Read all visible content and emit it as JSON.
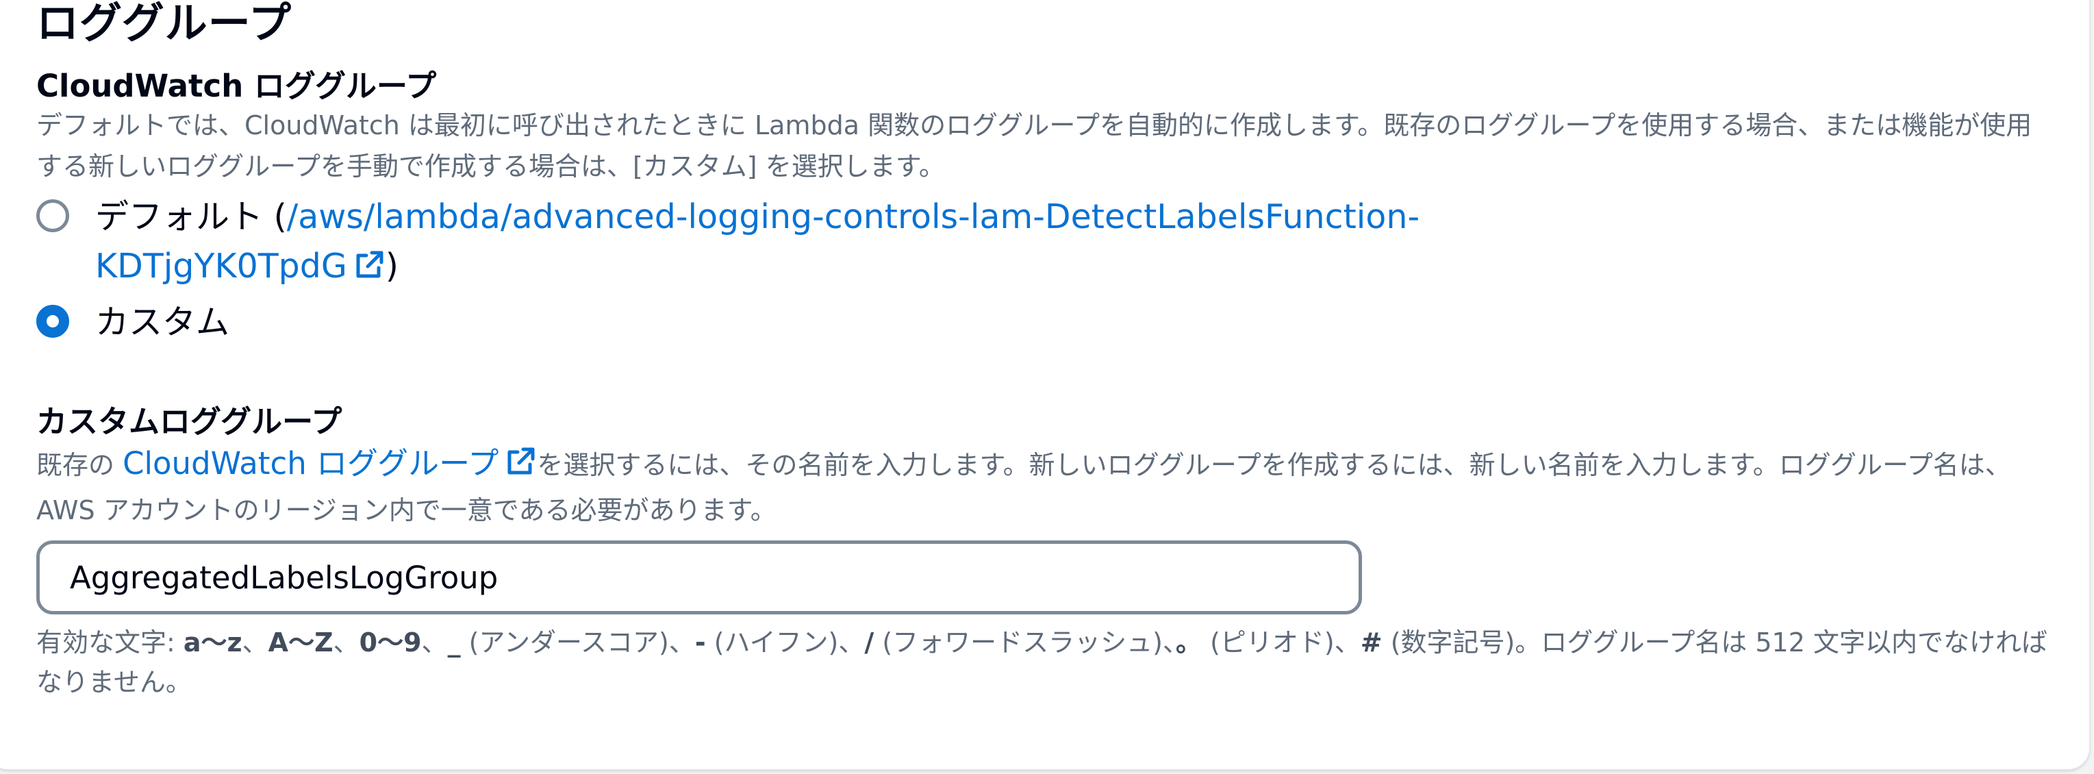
{
  "section": {
    "title": "ロググループ"
  },
  "cloudwatch": {
    "label": "CloudWatch ロググループ",
    "description": "デフォルトでは、CloudWatch は最初に呼び出されたときに Lambda 関数のロググループを自動的に作成します。既存のロググループを使用する場合、または機能が使用する新しいロググループを手動で作成する場合は、[カスタム] を選択します。",
    "options": {
      "default": {
        "label": "デフォルト (",
        "link": "/aws/lambda/advanced-logging-controls-lam-DetectLabelsFunction-",
        "link_cont": "KDTjgYK0TpdG",
        "close": ")",
        "selected": false
      },
      "custom": {
        "label": "カスタム",
        "selected": true
      }
    }
  },
  "custom_log_group": {
    "label": "カスタムロググループ",
    "desc_prefix": "既存の ",
    "desc_link": "CloudWatch ロググループ",
    "desc_suffix": "を選択するには、その名前を入力します。新しいロググループを作成するには、新しい名前を入力します。ロググループ名は、AWS アカウントのリージョン内で一意である必要があります。",
    "input_value": "AggregatedLabelsLogGroup"
  },
  "constraint": {
    "prefix": "有効な文字: ",
    "chars1": "a〜z",
    "sep1": "、",
    "chars2": "A〜Z",
    "sep2": "、",
    "chars3": "0〜9",
    "sep3": "、",
    "chars4": "_",
    "desc4": " (アンダースコア)、",
    "chars5": "-",
    "desc5": " (ハイフン)、",
    "chars6": "/",
    "desc6": " (フォワードスラッシュ)、",
    "chars7": "。",
    "desc7": " (ピリオド)、",
    "chars8": "#",
    "desc8": " (数字記号)。ロググループ名は 512 文字以内でなければなりません。"
  },
  "colors": {
    "link": "#0972d3",
    "text": "#000716",
    "muted": "#5f6b7a",
    "border": "#7d8998"
  },
  "icons": {
    "external_link": "external-link-icon"
  }
}
